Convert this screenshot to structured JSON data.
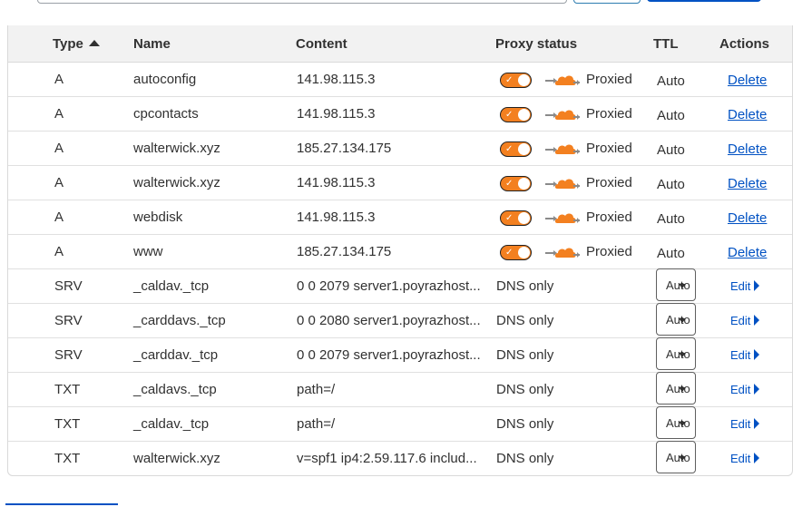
{
  "colors": {
    "accent": "#0051c3",
    "proxy_orange": "#f38020",
    "header_bg": "#f2f2f2"
  },
  "header": {
    "type": "Type",
    "name": "Name",
    "content": "Content",
    "proxy_status": "Proxy status",
    "ttl": "TTL",
    "actions": "Actions"
  },
  "rows": [
    {
      "type": "A",
      "name": "autoconfig",
      "content": "141.98.115.3",
      "proxy": "Proxied",
      "ttl": "Auto",
      "action": "Delete"
    },
    {
      "type": "A",
      "name": "cpcontacts",
      "content": "141.98.115.3",
      "proxy": "Proxied",
      "ttl": "Auto",
      "action": "Delete"
    },
    {
      "type": "A",
      "name": "walterwick.xyz",
      "content": "185.27.134.175",
      "proxy": "Proxied",
      "ttl": "Auto",
      "action": "Delete"
    },
    {
      "type": "A",
      "name": "walterwick.xyz",
      "content": "141.98.115.3",
      "proxy": "Proxied",
      "ttl": "Auto",
      "action": "Delete"
    },
    {
      "type": "A",
      "name": "webdisk",
      "content": "141.98.115.3",
      "proxy": "Proxied",
      "ttl": "Auto",
      "action": "Delete"
    },
    {
      "type": "A",
      "name": "www",
      "content": "185.27.134.175",
      "proxy": "Proxied",
      "ttl": "Auto",
      "action": "Delete"
    },
    {
      "type": "SRV",
      "name": "_caldav._tcp",
      "content": "0 0 2079 server1.poyrazhost...",
      "proxy": "DNS only",
      "ttl": "Auto",
      "action": "Edit"
    },
    {
      "type": "SRV",
      "name": "_carddavs._tcp",
      "content": "0 0 2080 server1.poyrazhost...",
      "proxy": "DNS only",
      "ttl": "Auto",
      "action": "Edit"
    },
    {
      "type": "SRV",
      "name": "_carddav._tcp",
      "content": "0 0 2079 server1.poyrazhost...",
      "proxy": "DNS only",
      "ttl": "Auto",
      "action": "Edit"
    },
    {
      "type": "TXT",
      "name": "_caldavs._tcp",
      "content": "path=/",
      "proxy": "DNS only",
      "ttl": "Auto",
      "action": "Edit"
    },
    {
      "type": "TXT",
      "name": "_caldav._tcp",
      "content": "path=/",
      "proxy": "DNS only",
      "ttl": "Auto",
      "action": "Edit"
    },
    {
      "type": "TXT",
      "name": "walterwick.xyz",
      "content": "v=spf1 ip4:2.59.117.6 includ...",
      "proxy": "DNS only",
      "ttl": "Auto",
      "action": "Edit"
    }
  ]
}
